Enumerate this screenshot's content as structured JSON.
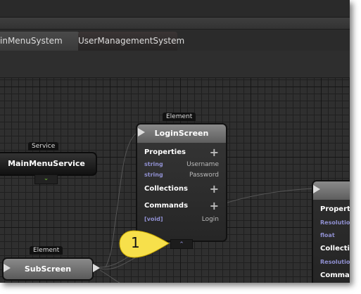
{
  "tabs": [
    {
      "label": "inMenuSystem"
    },
    {
      "label": "UserManagementSystem"
    }
  ],
  "nodes": {
    "main_menu_service": {
      "type": "Service",
      "title": "MainMenuService"
    },
    "login_screen": {
      "type": "Element",
      "title": "LoginScreen",
      "properties_label": "Properties",
      "properties": [
        {
          "type": "string",
          "name": "Username"
        },
        {
          "type": "string",
          "name": "Password"
        }
      ],
      "collections_label": "Collections",
      "commands_label": "Commands",
      "commands": [
        {
          "type": "[void]",
          "name": "Login"
        }
      ],
      "add": "+"
    },
    "sub_screen": {
      "type": "Element",
      "title": "SubScreen"
    },
    "right_node": {
      "properties_label": "Propert",
      "prop_type": "Resolutio",
      "prop_type2": "float",
      "collections_label": "Collectio",
      "coll_item": "Resolutio",
      "commands_label": "Comma"
    }
  },
  "callout": {
    "number": "1",
    "color": "#f7e04b"
  }
}
